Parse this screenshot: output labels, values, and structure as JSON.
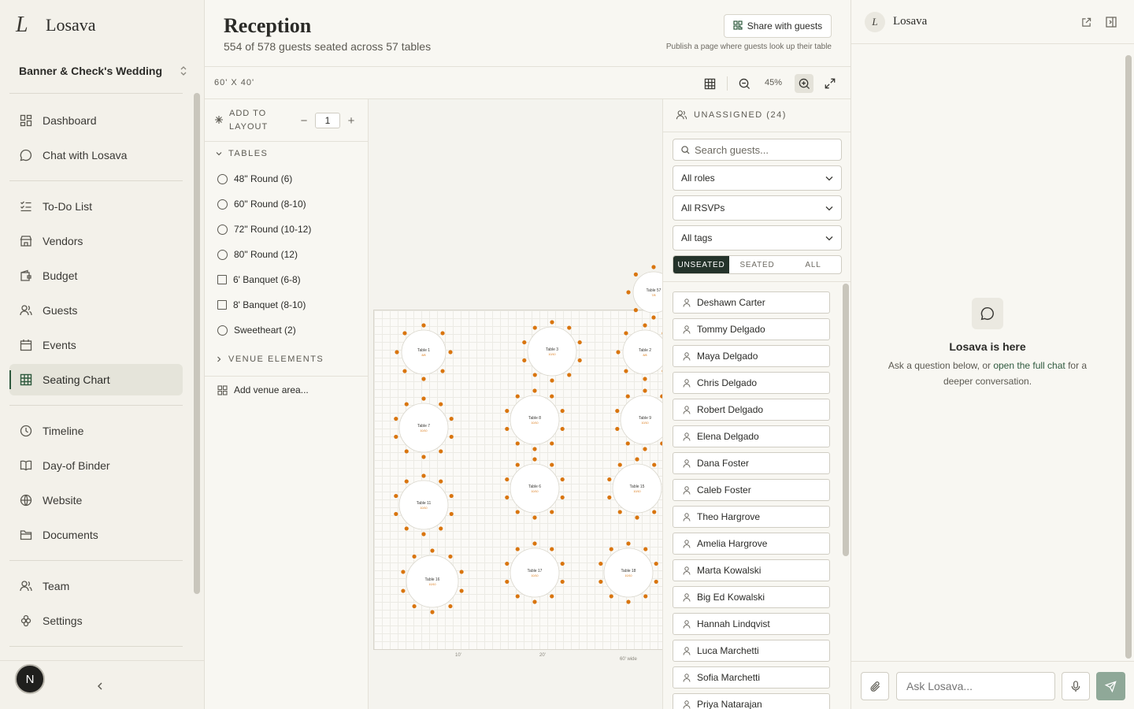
{
  "brand": {
    "name": "Losava",
    "mark": "L"
  },
  "wedding": {
    "name": "Banner & Check's Wedding"
  },
  "nav": {
    "dashboard": "Dashboard",
    "chat": "Chat with Losava",
    "todo": "To-Do List",
    "vendors": "Vendors",
    "budget": "Budget",
    "guests": "Guests",
    "events": "Events",
    "seating": "Seating Chart",
    "timeline": "Timeline",
    "binder": "Day-of Binder",
    "website": "Website",
    "documents": "Documents",
    "team": "Team",
    "settings": "Settings"
  },
  "user": {
    "initial": "N"
  },
  "page": {
    "title": "Reception",
    "subtitle": "554 of 578 guests seated across 57 tables",
    "share_label": "Share with guests",
    "share_hint": "Publish a page where guests look up their table"
  },
  "toolbar": {
    "dimensions": "60' X 40'",
    "zoom": "45%"
  },
  "palette": {
    "add_label": "ADD TO LAYOUT",
    "quantity": "1",
    "tables_header": "TABLES",
    "tables": [
      {
        "label": "48\" Round (6)",
        "shape": "circle"
      },
      {
        "label": "60\" Round (8-10)",
        "shape": "circle"
      },
      {
        "label": "72\" Round (10-12)",
        "shape": "circle"
      },
      {
        "label": "80\" Round (12)",
        "shape": "circle"
      },
      {
        "label": "6' Banquet (6-8)",
        "shape": "square"
      },
      {
        "label": "8' Banquet (8-10)",
        "shape": "square"
      },
      {
        "label": "Sweetheart (2)",
        "shape": "circle"
      }
    ],
    "venue_header": "VENUE ELEMENTS",
    "add_venue": "Add venue area..."
  },
  "canvas": {
    "ruler": [
      "10'",
      "20'",
      "60' wide"
    ],
    "tables": [
      {
        "name": "Table 57",
        "seats": "7/8"
      },
      {
        "name": "Table 1",
        "seats": "8/8"
      },
      {
        "name": "Table 3",
        "seats": "10/10"
      },
      {
        "name": "Table 2",
        "seats": "8/8"
      },
      {
        "name": "Table 7",
        "seats": "10/10"
      },
      {
        "name": "Table 8",
        "seats": "10/10"
      },
      {
        "name": "Table 9",
        "seats": "10/10"
      },
      {
        "name": "Table 11",
        "seats": "10/10"
      },
      {
        "name": "Table 6",
        "seats": "10/10"
      },
      {
        "name": "Table 15",
        "seats": "10/10"
      },
      {
        "name": "Table 16",
        "seats": "10/10"
      },
      {
        "name": "Table 17",
        "seats": "10/10"
      },
      {
        "name": "Table 18",
        "seats": "10/10"
      }
    ],
    "seat_color": "#d9750f"
  },
  "unassigned": {
    "header": "UNASSIGNED (24)",
    "search_placeholder": "Search guests...",
    "filter_roles": "All roles",
    "filter_rsvps": "All RSVPs",
    "filter_tags": "All tags",
    "seg_unseated": "UNSEATED",
    "seg_seated": "SEATED",
    "seg_all": "ALL",
    "guests": [
      "Deshawn Carter",
      "Tommy Delgado",
      "Maya Delgado",
      "Chris Delgado",
      "Robert Delgado",
      "Elena Delgado",
      "Dana Foster",
      "Caleb Foster",
      "Theo Hargrove",
      "Amelia Hargrove",
      "Marta Kowalski",
      "Big Ed Kowalski",
      "Hannah Lindqvist",
      "Luca Marchetti",
      "Sofia Marchetti",
      "Priya Natarajan"
    ]
  },
  "chat": {
    "name": "Losava",
    "empty_title": "Losava is here",
    "empty_desc_before": "Ask a question below, or ",
    "empty_desc_link": "open the full chat",
    "empty_desc_after": " for a deeper conversation.",
    "input_placeholder": "Ask Losava..."
  },
  "colors": {
    "accent": "#2f5a3e",
    "seat": "#d9750f",
    "active_nav": "#e5e4da"
  }
}
